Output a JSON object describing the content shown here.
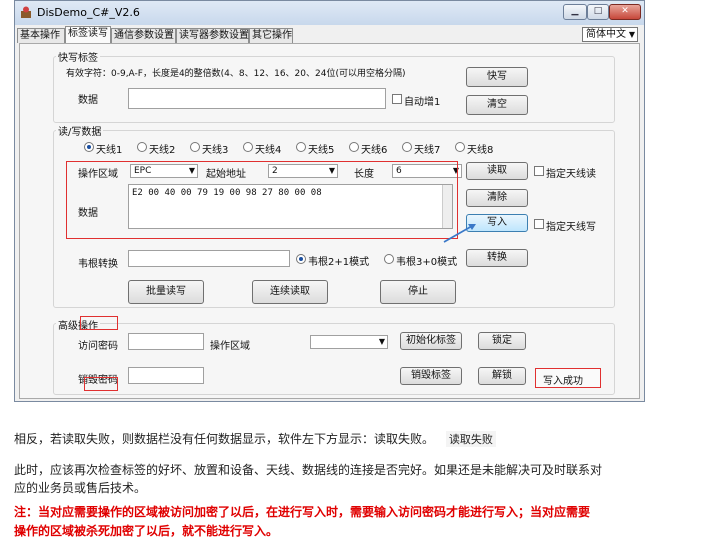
{
  "window": {
    "title": "DisDemo_C#_V2.6"
  },
  "tabs": [
    "基本操作",
    "标签读写",
    "通信参数设置",
    "读写器参数设置",
    "其它操作"
  ],
  "language": "简体中文",
  "quick": {
    "group_label": "快写标签",
    "hint": "有效字符：0-9,A-F，长度是4的整倍数(4、8、12、16、20、24位(可以用空格分隔)",
    "data_label": "数据",
    "auto_inc_label": "自动增1",
    "write_btn": "快写",
    "clear_btn": "清空"
  },
  "rw": {
    "group_label": "读/写数据",
    "antennas": [
      "天线1",
      "天线2",
      "天线3",
      "天线4",
      "天线5",
      "天线6",
      "天线7",
      "天线8"
    ],
    "area_label": "操作区域",
    "area_value": "EPC",
    "start_label": "起始地址",
    "start_value": "2",
    "length_label": "长度",
    "length_value": "6",
    "data_label": "数据",
    "data_value": "E2 00 40 00 79 19 00 98 27 80 00 08",
    "read_btn": "读取",
    "clear_btn": "清除",
    "write_btn": "写入",
    "ant_read_label": "指定天线读",
    "ant_write_label": "指定天线写",
    "wiegand_label": "韦根转换",
    "wiegand_mode1": "韦根2+1模式",
    "wiegand_mode2": "韦根3+0模式",
    "convert_btn": "转换",
    "batch_btn": "批量读写",
    "cont_btn": "连续读取",
    "stop_btn": "停止"
  },
  "adv": {
    "group_label": "高级操作",
    "access_label": "访问密码",
    "area_label": "操作区域",
    "init_btn": "初始化标签",
    "lock_btn": "锁定",
    "kill_label": "销毁密码",
    "kill_btn": "销毁标签",
    "unlock_btn": "解锁",
    "status": "写入成功"
  },
  "doc": {
    "p1": "相反，若读取失败，则数据栏没有任何数据显示，软件左下方显示：读取失败。",
    "p1_status": "读取失败",
    "p2_line1": "此时，应该再次检查标签的好坏、放置和设备、天线、数据线的连接是否完好。如果还是未能解决可及时联系对",
    "p2_line2": "应的业务员或售后技术。",
    "note_line1": "注：当对应需要操作的区域被访问加密了以后，在进行写入时，需要输入访问密码才能进行写入；当对应需要",
    "note_line2": "操作的区域被杀死加密了以后，就不能进行写入。"
  },
  "colors": {
    "annotation_red": "#e03030",
    "note_red": "#e00000",
    "arrow_blue": "#3a78c8"
  }
}
